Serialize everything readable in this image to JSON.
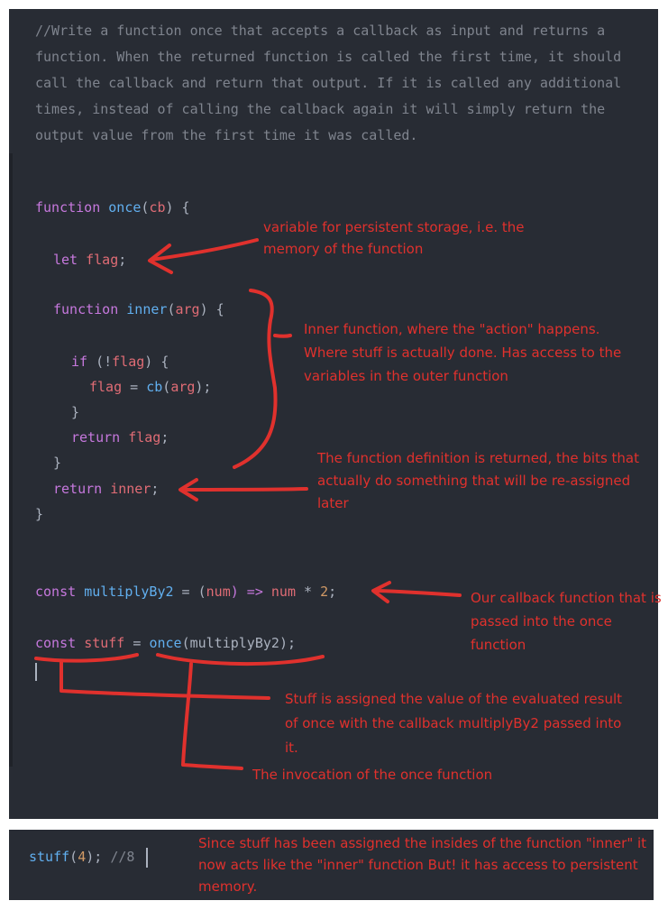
{
  "top_comment": "//Write a function once that accepts a callback as input and returns a function. When the returned function is called the first time, it should call the callback and return that output. If it is called any additional times, instead of calling the callback again it will simply return the output value from the first time it was called.",
  "code": {
    "l1": {
      "kw": "function",
      "name": "once",
      "open": "(",
      "param": "cb",
      "close": ") {"
    },
    "l2": {
      "kw": "let",
      "var": "flag",
      "end": ";"
    },
    "l3": {
      "kw": "function",
      "name": "inner",
      "open": "(",
      "param": "arg",
      "close": ") {"
    },
    "l4": {
      "kw": "if",
      "open": " (!",
      "var": "flag",
      "close": ") {"
    },
    "l5": {
      "var": "flag",
      "eq": " = ",
      "call": "cb",
      "open": "(",
      "param": "arg",
      "close": ");"
    },
    "l6": {
      "brace": "}"
    },
    "l7": {
      "kw": "return",
      "var": "flag",
      "end": ";"
    },
    "l8": {
      "brace": "}"
    },
    "l9": {
      "kw": "return",
      "var": "inner",
      "end": ";"
    },
    "l10": {
      "brace": "}"
    },
    "l11": {
      "kw": "const",
      "name": "multiplyBy2",
      "eq": " = ",
      "open": "(",
      "param": "num",
      "arrow": ") => ",
      "var": "num",
      "op": " * ",
      "num": "2",
      "end": ";"
    },
    "l12": {
      "kw": "const",
      "name": "stuff",
      "eq": " = ",
      "call": "once",
      "open": "(",
      "arg": "multiplyBy2",
      "close": ");"
    }
  },
  "bottom": {
    "call": "stuff",
    "open": "(",
    "num": "4",
    "close": "); ",
    "comment": "//8"
  },
  "annotations": {
    "a1": "variable for persistent storage, i.e. the memory of the function",
    "a2": "Inner function, where the \"action\" happens.  Where stuff is actually done. Has access to the variables in the outer function",
    "a3": "The function definition is returned, the bits that actually do something that will be re-assigned later",
    "a4": "Our callback function that is passed into the once function",
    "a5": "Stuff is assigned the value of the evaluated result of once with the callback multiplyBy2 passed into it.",
    "a6": "The invocation of the once function",
    "a7": "Since stuff has been assigned the insides of the function \"inner\" it now acts like the \"inner\" function But!  it has access to persistent memory."
  },
  "colors": {
    "editor_bg": "#282c34",
    "keyword": "#c678dd",
    "function": "#61afef",
    "variable": "#e06c75",
    "number": "#d19a66",
    "comment": "#7f848e",
    "ink": "#e0312d"
  }
}
